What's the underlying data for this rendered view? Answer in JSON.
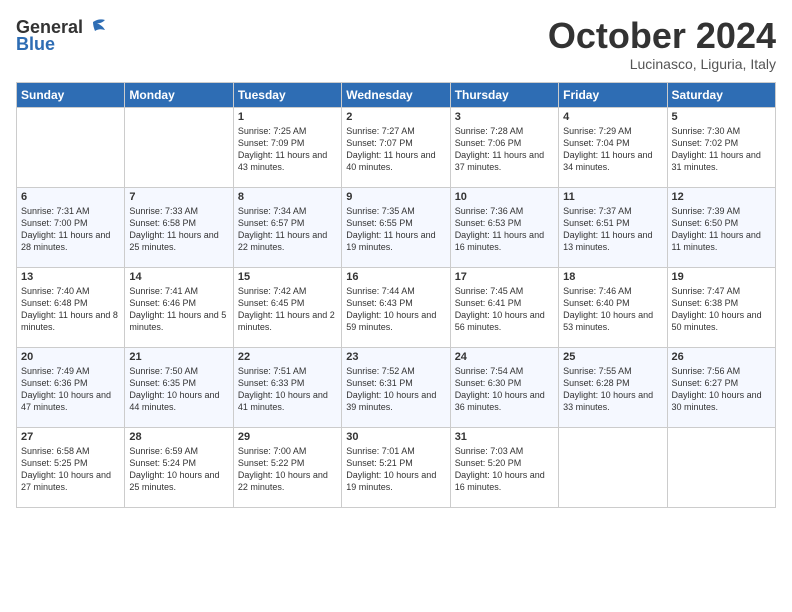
{
  "header": {
    "logo_general": "General",
    "logo_blue": "Blue",
    "month_title": "October 2024",
    "subtitle": "Lucinasco, Liguria, Italy"
  },
  "days_of_week": [
    "Sunday",
    "Monday",
    "Tuesday",
    "Wednesday",
    "Thursday",
    "Friday",
    "Saturday"
  ],
  "weeks": [
    [
      {
        "num": "",
        "sunrise": "",
        "sunset": "",
        "daylight": ""
      },
      {
        "num": "",
        "sunrise": "",
        "sunset": "",
        "daylight": ""
      },
      {
        "num": "1",
        "sunrise": "Sunrise: 7:25 AM",
        "sunset": "Sunset: 7:09 PM",
        "daylight": "Daylight: 11 hours and 43 minutes."
      },
      {
        "num": "2",
        "sunrise": "Sunrise: 7:27 AM",
        "sunset": "Sunset: 7:07 PM",
        "daylight": "Daylight: 11 hours and 40 minutes."
      },
      {
        "num": "3",
        "sunrise": "Sunrise: 7:28 AM",
        "sunset": "Sunset: 7:06 PM",
        "daylight": "Daylight: 11 hours and 37 minutes."
      },
      {
        "num": "4",
        "sunrise": "Sunrise: 7:29 AM",
        "sunset": "Sunset: 7:04 PM",
        "daylight": "Daylight: 11 hours and 34 minutes."
      },
      {
        "num": "5",
        "sunrise": "Sunrise: 7:30 AM",
        "sunset": "Sunset: 7:02 PM",
        "daylight": "Daylight: 11 hours and 31 minutes."
      }
    ],
    [
      {
        "num": "6",
        "sunrise": "Sunrise: 7:31 AM",
        "sunset": "Sunset: 7:00 PM",
        "daylight": "Daylight: 11 hours and 28 minutes."
      },
      {
        "num": "7",
        "sunrise": "Sunrise: 7:33 AM",
        "sunset": "Sunset: 6:58 PM",
        "daylight": "Daylight: 11 hours and 25 minutes."
      },
      {
        "num": "8",
        "sunrise": "Sunrise: 7:34 AM",
        "sunset": "Sunset: 6:57 PM",
        "daylight": "Daylight: 11 hours and 22 minutes."
      },
      {
        "num": "9",
        "sunrise": "Sunrise: 7:35 AM",
        "sunset": "Sunset: 6:55 PM",
        "daylight": "Daylight: 11 hours and 19 minutes."
      },
      {
        "num": "10",
        "sunrise": "Sunrise: 7:36 AM",
        "sunset": "Sunset: 6:53 PM",
        "daylight": "Daylight: 11 hours and 16 minutes."
      },
      {
        "num": "11",
        "sunrise": "Sunrise: 7:37 AM",
        "sunset": "Sunset: 6:51 PM",
        "daylight": "Daylight: 11 hours and 13 minutes."
      },
      {
        "num": "12",
        "sunrise": "Sunrise: 7:39 AM",
        "sunset": "Sunset: 6:50 PM",
        "daylight": "Daylight: 11 hours and 11 minutes."
      }
    ],
    [
      {
        "num": "13",
        "sunrise": "Sunrise: 7:40 AM",
        "sunset": "Sunset: 6:48 PM",
        "daylight": "Daylight: 11 hours and 8 minutes."
      },
      {
        "num": "14",
        "sunrise": "Sunrise: 7:41 AM",
        "sunset": "Sunset: 6:46 PM",
        "daylight": "Daylight: 11 hours and 5 minutes."
      },
      {
        "num": "15",
        "sunrise": "Sunrise: 7:42 AM",
        "sunset": "Sunset: 6:45 PM",
        "daylight": "Daylight: 11 hours and 2 minutes."
      },
      {
        "num": "16",
        "sunrise": "Sunrise: 7:44 AM",
        "sunset": "Sunset: 6:43 PM",
        "daylight": "Daylight: 10 hours and 59 minutes."
      },
      {
        "num": "17",
        "sunrise": "Sunrise: 7:45 AM",
        "sunset": "Sunset: 6:41 PM",
        "daylight": "Daylight: 10 hours and 56 minutes."
      },
      {
        "num": "18",
        "sunrise": "Sunrise: 7:46 AM",
        "sunset": "Sunset: 6:40 PM",
        "daylight": "Daylight: 10 hours and 53 minutes."
      },
      {
        "num": "19",
        "sunrise": "Sunrise: 7:47 AM",
        "sunset": "Sunset: 6:38 PM",
        "daylight": "Daylight: 10 hours and 50 minutes."
      }
    ],
    [
      {
        "num": "20",
        "sunrise": "Sunrise: 7:49 AM",
        "sunset": "Sunset: 6:36 PM",
        "daylight": "Daylight: 10 hours and 47 minutes."
      },
      {
        "num": "21",
        "sunrise": "Sunrise: 7:50 AM",
        "sunset": "Sunset: 6:35 PM",
        "daylight": "Daylight: 10 hours and 44 minutes."
      },
      {
        "num": "22",
        "sunrise": "Sunrise: 7:51 AM",
        "sunset": "Sunset: 6:33 PM",
        "daylight": "Daylight: 10 hours and 41 minutes."
      },
      {
        "num": "23",
        "sunrise": "Sunrise: 7:52 AM",
        "sunset": "Sunset: 6:31 PM",
        "daylight": "Daylight: 10 hours and 39 minutes."
      },
      {
        "num": "24",
        "sunrise": "Sunrise: 7:54 AM",
        "sunset": "Sunset: 6:30 PM",
        "daylight": "Daylight: 10 hours and 36 minutes."
      },
      {
        "num": "25",
        "sunrise": "Sunrise: 7:55 AM",
        "sunset": "Sunset: 6:28 PM",
        "daylight": "Daylight: 10 hours and 33 minutes."
      },
      {
        "num": "26",
        "sunrise": "Sunrise: 7:56 AM",
        "sunset": "Sunset: 6:27 PM",
        "daylight": "Daylight: 10 hours and 30 minutes."
      }
    ],
    [
      {
        "num": "27",
        "sunrise": "Sunrise: 6:58 AM",
        "sunset": "Sunset: 5:25 PM",
        "daylight": "Daylight: 10 hours and 27 minutes."
      },
      {
        "num": "28",
        "sunrise": "Sunrise: 6:59 AM",
        "sunset": "Sunset: 5:24 PM",
        "daylight": "Daylight: 10 hours and 25 minutes."
      },
      {
        "num": "29",
        "sunrise": "Sunrise: 7:00 AM",
        "sunset": "Sunset: 5:22 PM",
        "daylight": "Daylight: 10 hours and 22 minutes."
      },
      {
        "num": "30",
        "sunrise": "Sunrise: 7:01 AM",
        "sunset": "Sunset: 5:21 PM",
        "daylight": "Daylight: 10 hours and 19 minutes."
      },
      {
        "num": "31",
        "sunrise": "Sunrise: 7:03 AM",
        "sunset": "Sunset: 5:20 PM",
        "daylight": "Daylight: 10 hours and 16 minutes."
      },
      {
        "num": "",
        "sunrise": "",
        "sunset": "",
        "daylight": ""
      },
      {
        "num": "",
        "sunrise": "",
        "sunset": "",
        "daylight": ""
      }
    ]
  ]
}
